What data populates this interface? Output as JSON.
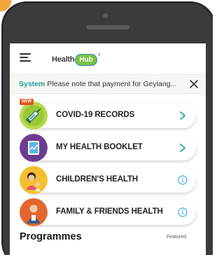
{
  "app": {
    "logo_text": "Health",
    "logo_badge": "Hub",
    "logo_mark": "®"
  },
  "notice": {
    "label": "System",
    "message": " Please note that payment for Geylang..."
  },
  "cards": [
    {
      "label": "COVID-19 RECORDS",
      "badge": "NEW",
      "action": "chevron-right-icon",
      "icon": "syringe-icon",
      "icon_bg": "#b6d94c"
    },
    {
      "label": "MY HEALTH BOOKLET",
      "action": "chevron-right-icon",
      "icon": "booklet-icon",
      "icon_bg": "#6b3c8f"
    },
    {
      "label": "CHILDREN'S HEALTH",
      "action": "info-icon",
      "icon": "child-icon",
      "icon_bg": "#f5c02d"
    },
    {
      "label": "FAMILY & FRIENDS HEALTH",
      "action": "info-icon",
      "icon": "family-icon",
      "icon_bg": "#e3652f"
    }
  ],
  "programmes": {
    "title": "Programmes",
    "featured": "Featured"
  },
  "colors": {
    "accent": "#1f9d9a",
    "chevron": "#2ab3a6",
    "info": "#3fa9dd",
    "new_badge": "#e4571e",
    "phone_body": "#2a2a2c"
  }
}
